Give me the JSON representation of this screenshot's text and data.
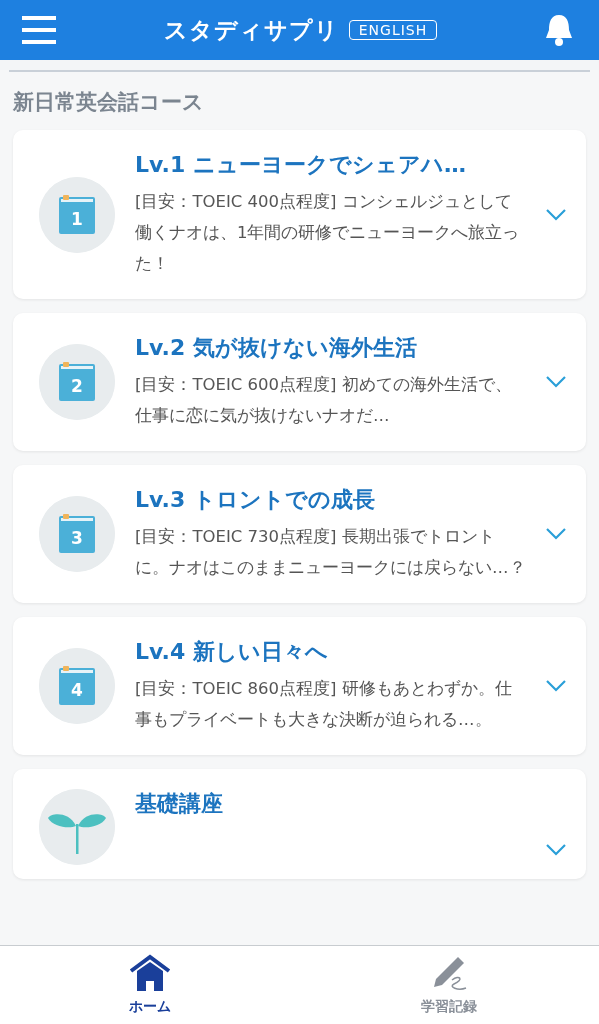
{
  "header": {
    "logo": "スタディサプリ",
    "logo_tag": "ENGLISH"
  },
  "section_title": "新日常英会話コース",
  "courses": [
    {
      "kind": "book",
      "number": "1",
      "title": "Lv.1 ニューヨークでシェアハ…",
      "description": "[目安：TOEIC 400点程度] コンシェルジュとして働くナオは、1年間の研修でニューヨークへ旅立った！"
    },
    {
      "kind": "book",
      "number": "2",
      "title": "Lv.2 気が抜けない海外生活",
      "description": "[目安：TOEIC 600点程度] 初めての海外生活で、仕事に恋に気が抜けないナオだ…"
    },
    {
      "kind": "book",
      "number": "3",
      "title": "Lv.3 トロントでの成長",
      "description": "[目安：TOEIC 730点程度] 長期出張でトロントに。ナオはこのままニューヨークには戻らない…？"
    },
    {
      "kind": "book",
      "number": "4",
      "title": "Lv.4 新しい日々へ",
      "description": "[目安：TOEIC 860点程度] 研修もあとわずか。仕事もプライベートも大きな決断が迫られる…。"
    },
    {
      "kind": "sprout",
      "title": "基礎講座"
    }
  ],
  "tabs": [
    {
      "kind": "home",
      "label": "ホーム",
      "selected": true
    },
    {
      "kind": "pencil",
      "label": "学習記録",
      "selected": false
    }
  ]
}
